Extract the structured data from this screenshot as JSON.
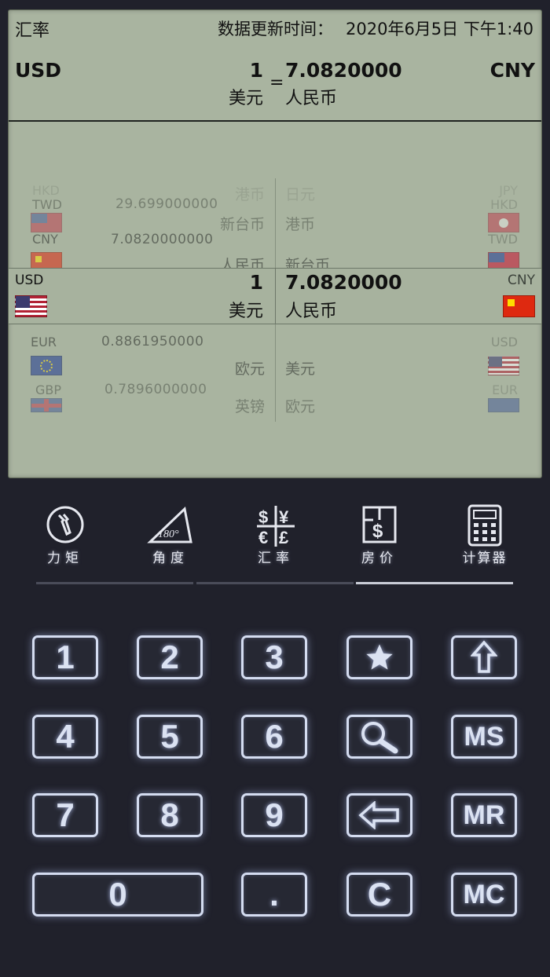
{
  "header": {
    "title": "汇率",
    "updated_label": "数据更新时间：",
    "updated_time": "2020年6月5日 下午1:40"
  },
  "conversion": {
    "from_code": "USD",
    "to_code": "CNY",
    "amount": "1",
    "equals": "=",
    "value": "7.0820000",
    "from_name": "美元",
    "to_name": "人民币"
  },
  "wheel": {
    "row_faint_top": {
      "code_left": "HKD",
      "name_left": "港币",
      "name_right": "日元",
      "code_right": "JPY"
    },
    "row_prev2": {
      "code_left": "TWD",
      "rate_left": "29.699000000",
      "name_left": "新台币",
      "name_right": "港币",
      "code_right": "HKD"
    },
    "row_prev1": {
      "code_left": "CNY",
      "rate_left": "7.0820000000",
      "name_left": "人民币",
      "name_right": "新台币",
      "code_right": "TWD"
    },
    "selected": {
      "code_left": "USD",
      "amount": "1",
      "name_left": "美元",
      "value": "7.0820000",
      "name_right": "人民币",
      "code_right": "CNY"
    },
    "row_next1": {
      "code_left": "EUR",
      "rate_left": "0.8861950000",
      "name_left": "欧元",
      "name_right": "美元",
      "code_right": "USD"
    },
    "row_next2": {
      "code_left": "GBP",
      "rate_left": "0.7896000000",
      "name_left": "英镑",
      "name_right": "欧元",
      "code_right": "EUR"
    }
  },
  "tabs": [
    {
      "id": "torque",
      "label": "力矩",
      "icon": "wrench-icon"
    },
    {
      "id": "angle",
      "label": "角度",
      "icon": "angle-180-icon",
      "icon_text": "180°"
    },
    {
      "id": "exchange",
      "label": "汇率",
      "icon": "currency-icon",
      "icon_text": "$¥€£"
    },
    {
      "id": "house",
      "label": "房价",
      "icon": "house-price-icon"
    },
    {
      "id": "calculator",
      "label": "计算器",
      "icon": "calculator-icon"
    }
  ],
  "keys": {
    "k1": "1",
    "k2": "2",
    "k3": "3",
    "k4": "4",
    "k5": "5",
    "k6": "6",
    "k7": "7",
    "k8": "8",
    "k9": "9",
    "k0": "0",
    "dot": ".",
    "clear": "C",
    "ms": "MS",
    "mr": "MR",
    "mc": "MC"
  },
  "colors": {
    "lcd": "#a9b4a0",
    "panel": "#20212b",
    "key_glow": "#d4dcf0"
  }
}
